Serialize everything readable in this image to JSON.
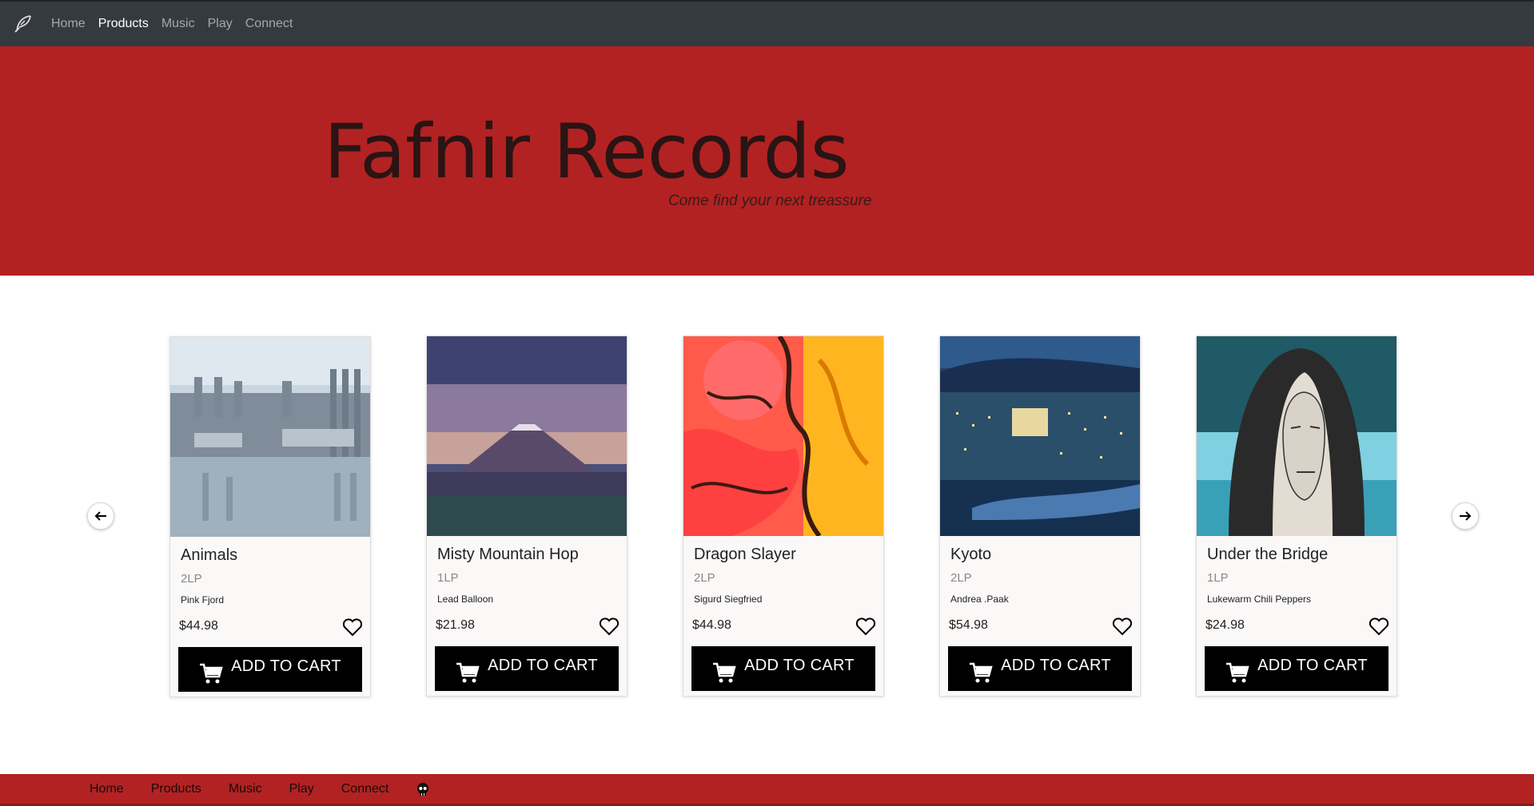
{
  "nav": {
    "brand_icon": "feather-icon",
    "items": [
      {
        "label": "Home",
        "active": false
      },
      {
        "label": "Products",
        "active": true
      },
      {
        "label": "Music",
        "active": false
      },
      {
        "label": "Play",
        "active": false
      },
      {
        "label": "Connect",
        "active": false
      }
    ]
  },
  "hero": {
    "title": "Fafnir Records",
    "subtitle": "Come find your next treassure",
    "background": "#b22222"
  },
  "carousel": {
    "prev_icon": "arrow-left-icon",
    "next_icon": "arrow-right-icon",
    "products": [
      {
        "title": "Animals",
        "format": "2LP",
        "artist": "Pink Fjord",
        "price": "$44.98",
        "button": "ADD TO CART",
        "art": "factory-reflection"
      },
      {
        "title": "Misty Mountain Hop",
        "format": "1LP",
        "artist": "Lead Balloon",
        "price": "$21.98",
        "button": "ADD TO CART",
        "art": "mountain-dusk"
      },
      {
        "title": "Dragon Slayer",
        "format": "2LP",
        "artist": "Sigurd Siegfried",
        "price": "$44.98",
        "button": "ADD TO CART",
        "art": "red-dragon"
      },
      {
        "title": "Kyoto",
        "format": "2LP",
        "artist": "Andrea .Paak",
        "price": "$54.98",
        "button": "ADD TO CART",
        "art": "city-night"
      },
      {
        "title": "Under the Bridge",
        "format": "1LP",
        "artist": "Lukewarm Chili Peppers",
        "price": "$24.98",
        "button": "ADD TO CART",
        "art": "hooded-figure"
      }
    ]
  },
  "footer": {
    "items": [
      "Home",
      "Products",
      "Music",
      "Play",
      "Connect"
    ],
    "end_icon": "skull-icon"
  },
  "colors": {
    "navbar": "#343a40",
    "brand_red": "#b22222",
    "button": "#000000"
  }
}
